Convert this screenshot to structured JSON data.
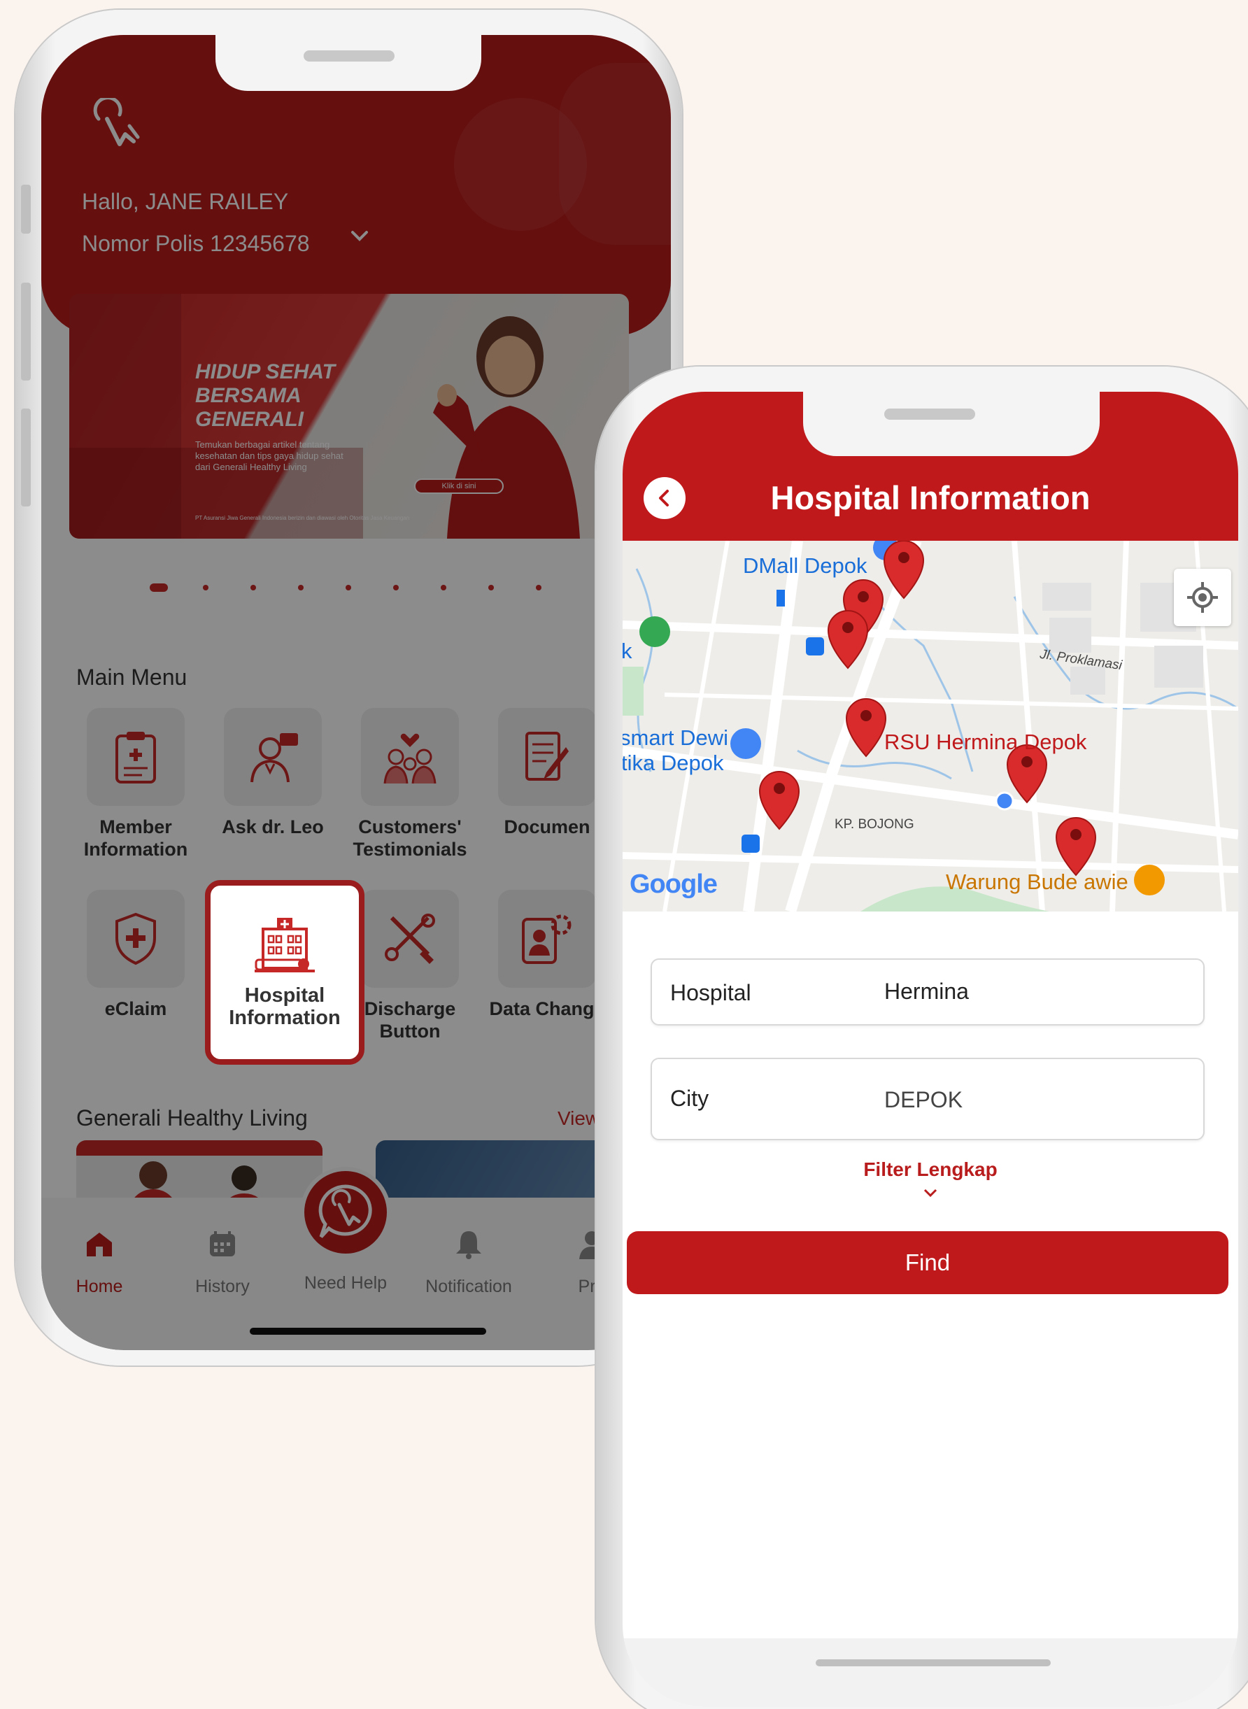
{
  "screen1": {
    "greeting": "Hallo, JANE RAILEY",
    "policy": "Nomor Polis 12345678",
    "banner": {
      "title": "HIDUP SEHAT\nBERSAMA\nGENERALI",
      "subtitle": "Temukan berbagai artikel tentang\nkesehatan dan tips gaya hidup sehat\ndari Generali Healthy Living",
      "cta": "Klik di sini",
      "legal": "PT Asuransi Jiwa Generali Indonesia berizin dan diawasi oleh Otoritas Jasa Keuangan"
    },
    "main_menu_title": "Main Menu",
    "menu": [
      {
        "label": "Member\nInformation",
        "icon": "clipboard-medical-icon"
      },
      {
        "label": "Ask dr. Leo",
        "icon": "doctor-icon"
      },
      {
        "label": "Customers'\nTestimonials",
        "icon": "family-heart-icon"
      },
      {
        "label": "Documen",
        "icon": "document-edit-icon"
      },
      {
        "label": "eClaim",
        "icon": "shield-cross-icon"
      },
      {
        "label": "Hospital\nInformation",
        "icon": "hospital-icon"
      },
      {
        "label": "Discharge\nButton",
        "icon": "tools-icon"
      },
      {
        "label": "Data Change",
        "icon": "profile-settings-icon"
      }
    ],
    "ghl_title": "Generali Healthy Living",
    "ghl_view": "View",
    "nav": [
      {
        "label": "Home",
        "icon": "home-icon"
      },
      {
        "label": "History",
        "icon": "calendar-icon"
      },
      {
        "label": "Need Help",
        "icon": "chat-hand-icon"
      },
      {
        "label": "Notification",
        "icon": "bell-icon"
      },
      {
        "label": "Pro",
        "icon": "profile-icon"
      }
    ]
  },
  "screen2": {
    "title": "Hospital Information",
    "map": {
      "labels": [
        "DMall Depok",
        "k",
        "smart Dewi",
        "tika Depok",
        "RSU Hermina Depok",
        "Jl. Proklamasi",
        "KP. BOJONG",
        "Warung Bude awie"
      ],
      "attribution": "Google"
    },
    "hospital_label": "Hospital",
    "hospital_value": "Hermina",
    "city_label": "City",
    "city_value": "DEPOK",
    "filter_label": "Filter Lengkap",
    "find_label": "Find"
  },
  "colors": {
    "brand_red": "#c0191c",
    "dark_red": "#9b1c1c"
  }
}
